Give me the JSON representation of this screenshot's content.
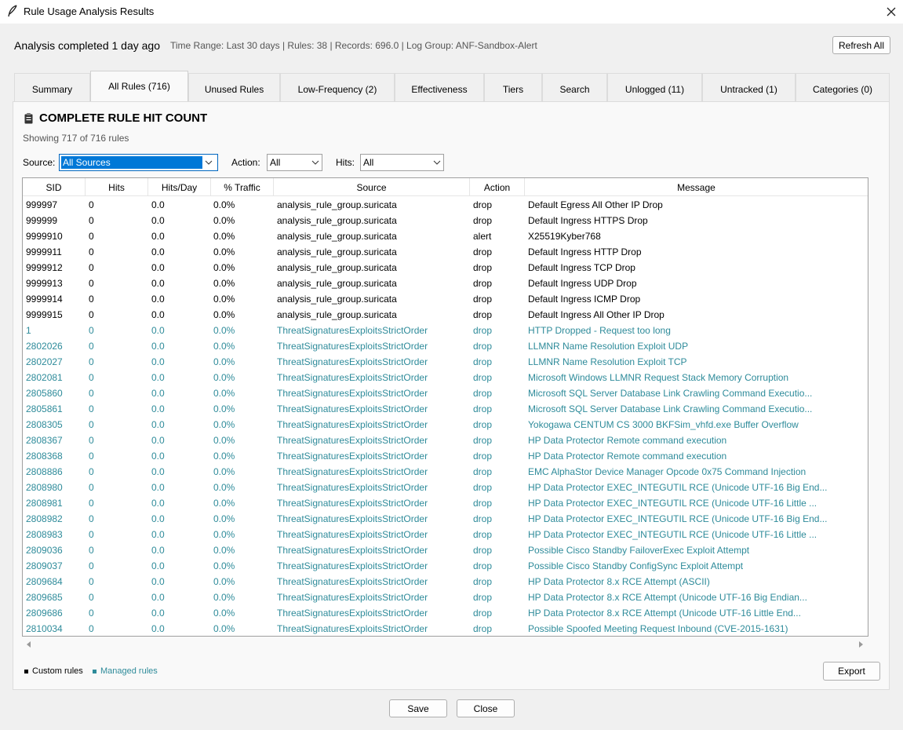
{
  "window": {
    "title": "Rule Usage Analysis Results"
  },
  "status": {
    "main": "Analysis completed 1 day ago",
    "meta": "Time Range: Last 30 days | Rules: 38 | Records: 696.0 | Log Group: ANF-Sandbox-Alert",
    "refresh_label": "Refresh All"
  },
  "tabs": [
    {
      "label": "Summary",
      "active": false
    },
    {
      "label": "All Rules (716)",
      "active": true
    },
    {
      "label": "Unused Rules",
      "active": false
    },
    {
      "label": "Low-Frequency (2)",
      "active": false
    },
    {
      "label": "Effectiveness",
      "active": false
    },
    {
      "label": "Tiers",
      "active": false
    },
    {
      "label": "Search",
      "active": false
    },
    {
      "label": "Unlogged (11)",
      "active": false
    },
    {
      "label": "Untracked (1)",
      "active": false
    },
    {
      "label": "Categories (0)",
      "active": false
    }
  ],
  "panel": {
    "heading": "COMPLETE RULE HIT COUNT",
    "heading_icon": "clipboard-icon",
    "showing": "Showing 717 of 716 rules"
  },
  "filters": {
    "source_label": "Source:",
    "source_value": "All Sources",
    "action_label": "Action:",
    "action_value": "All",
    "hits_label": "Hits:",
    "hits_value": "All"
  },
  "table": {
    "columns": [
      "SID",
      "Hits",
      "Hits/Day",
      "% Traffic",
      "Source",
      "Action",
      "Message"
    ],
    "rows": [
      {
        "type": "custom",
        "cells": [
          "999997",
          "0",
          "0.0",
          "0.0%",
          "analysis_rule_group.suricata",
          "drop",
          "Default Egress All Other IP Drop"
        ]
      },
      {
        "type": "custom",
        "cells": [
          "999999",
          "0",
          "0.0",
          "0.0%",
          "analysis_rule_group.suricata",
          "drop",
          "Default Ingress HTTPS Drop"
        ]
      },
      {
        "type": "custom",
        "cells": [
          "9999910",
          "0",
          "0.0",
          "0.0%",
          "analysis_rule_group.suricata",
          "alert",
          "X25519Kyber768"
        ]
      },
      {
        "type": "custom",
        "cells": [
          "9999911",
          "0",
          "0.0",
          "0.0%",
          "analysis_rule_group.suricata",
          "drop",
          "Default Ingress HTTP Drop"
        ]
      },
      {
        "type": "custom",
        "cells": [
          "9999912",
          "0",
          "0.0",
          "0.0%",
          "analysis_rule_group.suricata",
          "drop",
          "Default Ingress TCP Drop"
        ]
      },
      {
        "type": "custom",
        "cells": [
          "9999913",
          "0",
          "0.0",
          "0.0%",
          "analysis_rule_group.suricata",
          "drop",
          "Default Ingress UDP Drop"
        ]
      },
      {
        "type": "custom",
        "cells": [
          "9999914",
          "0",
          "0.0",
          "0.0%",
          "analysis_rule_group.suricata",
          "drop",
          "Default Ingress ICMP Drop"
        ]
      },
      {
        "type": "custom",
        "cells": [
          "9999915",
          "0",
          "0.0",
          "0.0%",
          "analysis_rule_group.suricata",
          "drop",
          "Default Ingress All Other IP Drop"
        ]
      },
      {
        "type": "managed",
        "cells": [
          "1",
          "0",
          "0.0",
          "0.0%",
          "ThreatSignaturesExploitsStrictOrder",
          "drop",
          "HTTP Dropped - Request too long"
        ]
      },
      {
        "type": "managed",
        "cells": [
          "2802026",
          "0",
          "0.0",
          "0.0%",
          "ThreatSignaturesExploitsStrictOrder",
          "drop",
          "LLMNR Name Resolution Exploit UDP"
        ]
      },
      {
        "type": "managed",
        "cells": [
          "2802027",
          "0",
          "0.0",
          "0.0%",
          "ThreatSignaturesExploitsStrictOrder",
          "drop",
          "LLMNR Name Resolution Exploit TCP"
        ]
      },
      {
        "type": "managed",
        "cells": [
          "2802081",
          "0",
          "0.0",
          "0.0%",
          "ThreatSignaturesExploitsStrictOrder",
          "drop",
          "Microsoft Windows LLMNR Request Stack Memory Corruption"
        ]
      },
      {
        "type": "managed",
        "cells": [
          "2805860",
          "0",
          "0.0",
          "0.0%",
          "ThreatSignaturesExploitsStrictOrder",
          "drop",
          "Microsoft SQL Server Database Link Crawling Command Executio..."
        ]
      },
      {
        "type": "managed",
        "cells": [
          "2805861",
          "0",
          "0.0",
          "0.0%",
          "ThreatSignaturesExploitsStrictOrder",
          "drop",
          "Microsoft SQL Server Database Link Crawling Command Executio..."
        ]
      },
      {
        "type": "managed",
        "cells": [
          "2808305",
          "0",
          "0.0",
          "0.0%",
          "ThreatSignaturesExploitsStrictOrder",
          "drop",
          "Yokogawa CENTUM CS 3000 BKFSim_vhfd.exe Buffer Overflow"
        ]
      },
      {
        "type": "managed",
        "cells": [
          "2808367",
          "0",
          "0.0",
          "0.0%",
          "ThreatSignaturesExploitsStrictOrder",
          "drop",
          "HP Data Protector Remote command execution"
        ]
      },
      {
        "type": "managed",
        "cells": [
          "2808368",
          "0",
          "0.0",
          "0.0%",
          "ThreatSignaturesExploitsStrictOrder",
          "drop",
          "HP Data Protector Remote command execution"
        ]
      },
      {
        "type": "managed",
        "cells": [
          "2808886",
          "0",
          "0.0",
          "0.0%",
          "ThreatSignaturesExploitsStrictOrder",
          "drop",
          "EMC AlphaStor Device Manager Opcode 0x75 Command Injection"
        ]
      },
      {
        "type": "managed",
        "cells": [
          "2808980",
          "0",
          "0.0",
          "0.0%",
          "ThreatSignaturesExploitsStrictOrder",
          "drop",
          "HP Data Protector EXEC_INTEGUTIL RCE (Unicode UTF-16 Big End..."
        ]
      },
      {
        "type": "managed",
        "cells": [
          "2808981",
          "0",
          "0.0",
          "0.0%",
          "ThreatSignaturesExploitsStrictOrder",
          "drop",
          "HP Data Protector EXEC_INTEGUTIL RCE (Unicode UTF-16 Little ..."
        ]
      },
      {
        "type": "managed",
        "cells": [
          "2808982",
          "0",
          "0.0",
          "0.0%",
          "ThreatSignaturesExploitsStrictOrder",
          "drop",
          "HP Data Protector EXEC_INTEGUTIL RCE (Unicode UTF-16 Big End..."
        ]
      },
      {
        "type": "managed",
        "cells": [
          "2808983",
          "0",
          "0.0",
          "0.0%",
          "ThreatSignaturesExploitsStrictOrder",
          "drop",
          "HP Data Protector EXEC_INTEGUTIL RCE (Unicode UTF-16 Little ..."
        ]
      },
      {
        "type": "managed",
        "cells": [
          "2809036",
          "0",
          "0.0",
          "0.0%",
          "ThreatSignaturesExploitsStrictOrder",
          "drop",
          "Possible Cisco Standby FailoverExec Exploit Attempt"
        ]
      },
      {
        "type": "managed",
        "cells": [
          "2809037",
          "0",
          "0.0",
          "0.0%",
          "ThreatSignaturesExploitsStrictOrder",
          "drop",
          "Possible Cisco Standby ConfigSync Exploit Attempt"
        ]
      },
      {
        "type": "managed",
        "cells": [
          "2809684",
          "0",
          "0.0",
          "0.0%",
          "ThreatSignaturesExploitsStrictOrder",
          "drop",
          "HP Data Protector 8.x RCE Attempt (ASCII)"
        ]
      },
      {
        "type": "managed",
        "cells": [
          "2809685",
          "0",
          "0.0",
          "0.0%",
          "ThreatSignaturesExploitsStrictOrder",
          "drop",
          "HP Data Protector 8.x RCE Attempt (Unicode UTF-16 Big Endian..."
        ]
      },
      {
        "type": "managed",
        "cells": [
          "2809686",
          "0",
          "0.0",
          "0.0%",
          "ThreatSignaturesExploitsStrictOrder",
          "drop",
          "HP Data Protector 8.x RCE Attempt (Unicode UTF-16 Little End..."
        ]
      },
      {
        "type": "managed",
        "cells": [
          "2810034",
          "0",
          "0.0",
          "0.0%",
          "ThreatSignaturesExploitsStrictOrder",
          "drop",
          "Possible Spoofed Meeting Request Inbound (CVE-2015-1631)"
        ]
      }
    ]
  },
  "legend": {
    "custom": "Custom rules",
    "managed": "Managed rules"
  },
  "buttons": {
    "export": "Export",
    "save": "Save",
    "close": "Close"
  },
  "colors": {
    "custom_text": "#000000",
    "managed_text": "#2e8b9a",
    "selection": "#0078d7"
  }
}
